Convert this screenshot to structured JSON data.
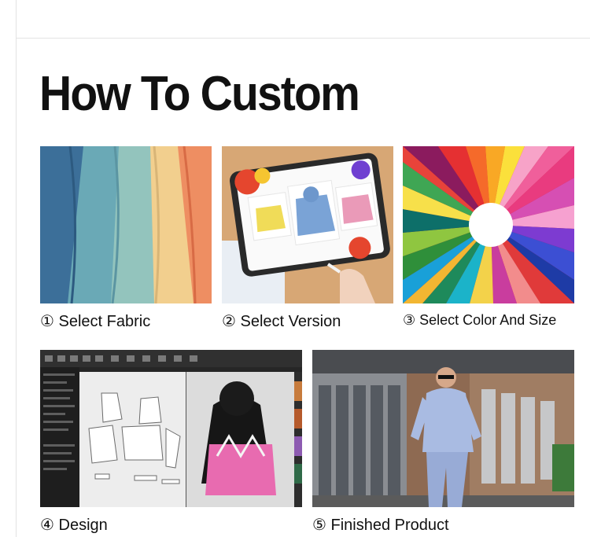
{
  "heading": "How To Custom",
  "steps": [
    {
      "number": "①",
      "label": "Select Fabric",
      "image": "fabric-swatches-image"
    },
    {
      "number": "②",
      "label": "Select Version",
      "image": "tablet-hoodie-image"
    },
    {
      "number": "③",
      "label": "Select Color And Size",
      "image": "color-wheel-image"
    },
    {
      "number": "④",
      "label": "Design",
      "image": "design-software-image"
    },
    {
      "number": "⑤",
      "label": "Finished Product",
      "image": "finished-product-photo"
    }
  ],
  "colors": {
    "text": "#111111",
    "divider": "#e3e3e3",
    "design_hoodie_print": "#e86bb0"
  }
}
